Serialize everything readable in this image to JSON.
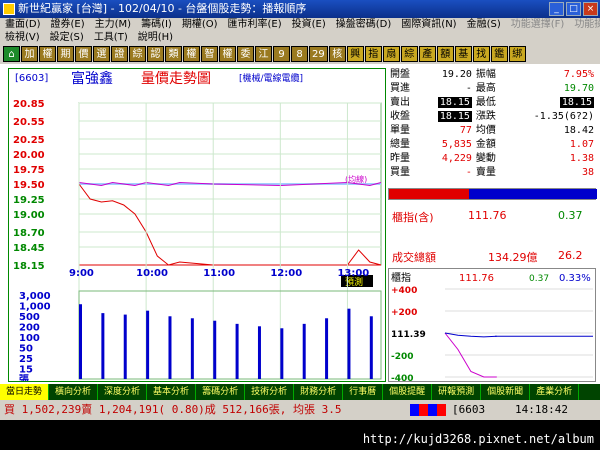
{
  "window": {
    "title": "新世紀贏家 [台灣] - 102/04/10 - 台盤個股走勢：播報順序"
  },
  "menu": {
    "row1": [
      "畫面(D)",
      "證券(E)",
      "主力(M)",
      "籌碼(I)",
      "期權(O)",
      "匯市利率(E)",
      "投資(E)",
      "操盤密碼(D)",
      "國際資訊(N)",
      "金融(S)",
      "功能選擇(F)",
      "功能操作(T)"
    ],
    "row2": [
      "檢視(V)",
      "設定(S)",
      "工具(T)",
      "說明(H)"
    ]
  },
  "toolbar": {
    "buttons": [
      "⌂",
      "加",
      "權",
      "期",
      "價",
      "選",
      "證",
      "綜",
      "認",
      "類",
      "權",
      "智",
      "權",
      "委",
      "江",
      "9",
      "8",
      "29",
      "核",
      "興",
      "指",
      "扇",
      "綜",
      "產",
      "額",
      "基",
      "找",
      "鑑",
      "綁"
    ]
  },
  "chart": {
    "header_code": "[6603]",
    "header_name": "富強鑫",
    "header_title": "量價走勢圖",
    "header_tag": "[機械/電線電纜]",
    "avg_label": "(均線)",
    "price_ticks": [
      "20.85",
      "20.55",
      "20.25",
      "20.00",
      "19.75",
      "19.50",
      "19.25",
      "19.00",
      "18.70",
      "18.45",
      "18.15"
    ],
    "ref_price": "19.50",
    "time_ticks": [
      "9:00",
      "10:00",
      "11:00",
      "12:00",
      "13:00"
    ],
    "volume_ticks": [
      "3,000",
      "1,000",
      "500",
      "200",
      "100",
      "50",
      "25",
      "15",
      "張"
    ],
    "forecast_label": "預測"
  },
  "chart_data": [
    {
      "type": "line",
      "title": "量價走勢圖",
      "xlabel": "",
      "ylabel": "",
      "ylim": [
        18.15,
        20.85
      ],
      "x": [
        "9:00",
        "9:10",
        "9:20",
        "9:30",
        "9:40",
        "9:50",
        "10:00",
        "10:10",
        "10:20",
        "10:30",
        "11:00",
        "12:00",
        "13:00",
        "13:10",
        "13:20",
        "13:30"
      ],
      "series": [
        {
          "values": [
            19.5,
            19.25,
            19.2,
            19.22,
            19.15,
            19.0,
            18.7,
            18.3,
            18.15,
            18.2,
            18.15,
            18.15,
            18.15,
            18.4,
            18.2,
            18.15
          ]
        }
      ]
    },
    {
      "type": "bar",
      "title": "",
      "xlabel": "",
      "ylabel": "張",
      "ylim": [
        0,
        3000
      ],
      "categories": [
        "9:00",
        "9:20",
        "9:40",
        "10:00",
        "10:20",
        "10:40",
        "11:00",
        "11:20",
        "11:40",
        "12:00",
        "12:20",
        "12:40",
        "13:00",
        "13:20"
      ],
      "values": [
        900,
        400,
        350,
        500,
        300,
        250,
        200,
        150,
        120,
        100,
        150,
        250,
        600,
        300
      ]
    },
    {
      "type": "line",
      "title": "",
      "xlabel": "",
      "ylabel": "",
      "ylim": [
        -400,
        400
      ],
      "x": [
        "9:00",
        "10:00",
        "11:00",
        "12:00",
        "13:00"
      ],
      "series": [
        {
          "values": [
            0,
            -150,
            -350,
            -400,
            -400
          ]
        },
        {
          "values": [
            0,
            -20,
            -30,
            -35,
            -30
          ]
        }
      ]
    }
  ],
  "quote": {
    "rows": [
      {
        "l1": "開盤",
        "v1": "19.20",
        "l2": "振幅",
        "v2": "7.95%",
        "c1": "blk",
        "c2": "red"
      },
      {
        "l1": "買進",
        "v1": "-",
        "l2": "最高",
        "v2": "19.70",
        "c1": "blk",
        "c2": "grn"
      },
      {
        "l1": "賣出",
        "v1": "18.15",
        "l2": "最低",
        "v2": "18.15",
        "c1": "box",
        "c2": "box"
      },
      {
        "l1": "收盤",
        "v1": "18.15",
        "l2": "漲跌",
        "v2": "-1.35(6?2)",
        "c1": "box",
        "c2": "blk"
      },
      {
        "l1": "單量",
        "v1": "77",
        "l2": "均價",
        "v2": "18.42",
        "c1": "red",
        "c2": "blk"
      },
      {
        "l1": "總量",
        "v1": "5,835",
        "l2": "金額",
        "v2": "1.07",
        "c1": "red",
        "c2": "red"
      },
      {
        "l1": "昨量",
        "v1": "4,229",
        "l2": "變動",
        "v2": "1.38",
        "c1": "red",
        "c2": "red"
      },
      {
        "l1": "買量",
        "v1": "-",
        "l2": "賣量",
        "v2": "38",
        "c1": "red",
        "c2": "red"
      }
    ],
    "index_label": "櫃指(含)",
    "index_value": "111.76",
    "index_change": "0.37",
    "turnover_label": "成交總額",
    "turnover_value": "134.29億",
    "turnover_pct": "26.2"
  },
  "otc": {
    "label": "櫃指",
    "value": "111.76",
    "change": "0.37",
    "pct": "0.33%",
    "ticks": [
      "+400",
      "+200",
      "111.39",
      "-200",
      "-400"
    ]
  },
  "tabs": [
    "當日走勢",
    "橫向分析",
    "深度分析",
    "基本分析",
    "籌碼分析",
    "技術分析",
    "財務分析",
    "行事曆",
    "個股提醒",
    "研報預測",
    "個股新聞",
    "產業分析"
  ],
  "status": {
    "text": "買 1,502,239賣 1,204,191( 0.80)成 512,166張, 均張 3.5",
    "code": "[6603",
    "time": "14:18:42"
  },
  "footer": {
    "url": "http://kujd3268.pixnet.net/album"
  },
  "colors": {
    "up": "#e00000",
    "down": "#008800",
    "avg": "#cc00cc",
    "ref": "#a0d0ff"
  }
}
